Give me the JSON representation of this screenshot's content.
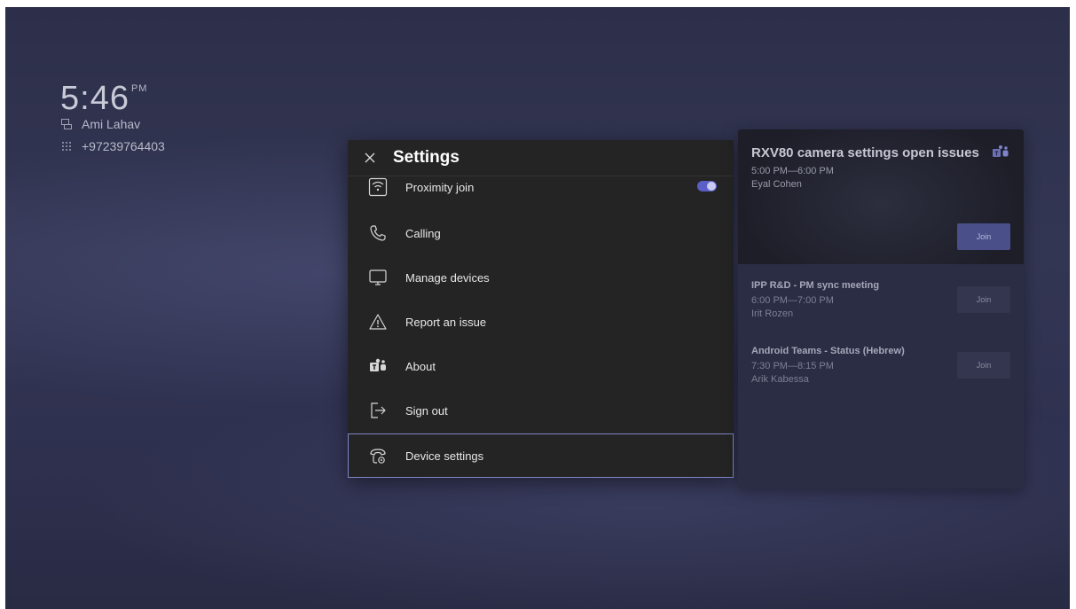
{
  "status": {
    "time": "5:46",
    "ampm": "PM",
    "user_name": "Ami Lahav",
    "phone_number": "+97239764403"
  },
  "settings": {
    "close_icon": "close-icon",
    "title": "Settings",
    "items": [
      {
        "label": "Proximity join",
        "icon": "wifi-box-icon",
        "toggle_on": true
      },
      {
        "label": "Calling",
        "icon": "phone-icon"
      },
      {
        "label": "Manage devices",
        "icon": "monitor-icon"
      },
      {
        "label": "Report an issue",
        "icon": "warning-icon"
      },
      {
        "label": "About",
        "icon": "teams-icon"
      },
      {
        "label": "Sign out",
        "icon": "sign-out-icon"
      },
      {
        "label": "Device settings",
        "icon": "phone-gear-icon",
        "focused": true
      }
    ]
  },
  "meetings": {
    "featured": {
      "title": "RXV80 camera settings open issues",
      "time": "5:00 PM—6:00 PM",
      "organizer": "Eyal Cohen",
      "join_label": "Join"
    },
    "list": [
      {
        "title": "IPP R&D - PM sync meeting",
        "time": "6:00 PM—7:00 PM",
        "organizer": "Irit Rozen",
        "join_label": "Join"
      },
      {
        "title": "Android Teams - Status (Hebrew)",
        "time": "7:30 PM—8:15 PM",
        "organizer": "Arik Kabessa",
        "join_label": "Join"
      }
    ]
  },
  "colors": {
    "accent": "#5b5fc7",
    "panel": "#242424",
    "background": "#2f3150"
  }
}
